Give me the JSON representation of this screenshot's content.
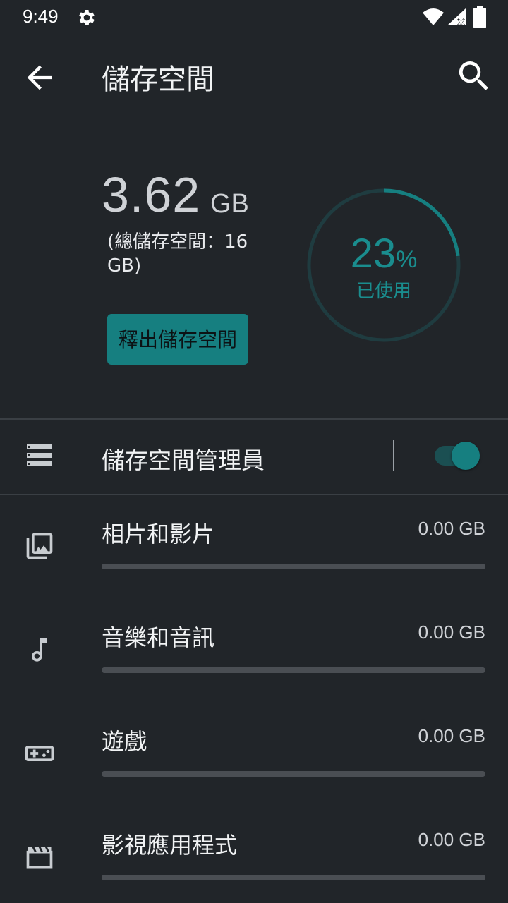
{
  "status": {
    "time": "9:49"
  },
  "header": {
    "title": "儲存空間"
  },
  "summary": {
    "used_value": "3.62",
    "used_unit": "GB",
    "total_text": "(總儲存空間：16 GB)",
    "free_button": "釋出儲存空間",
    "used_percent": 23,
    "percent_number": "23",
    "percent_symbol": "%",
    "used_label": "已使用"
  },
  "manager": {
    "label": "儲存空間管理員",
    "enabled": true
  },
  "categories": [
    {
      "label": "相片和影片",
      "size": "0.00 GB",
      "fraction": 0,
      "icon": "photo-library-icon"
    },
    {
      "label": "音樂和音訊",
      "size": "0.00 GB",
      "fraction": 0,
      "icon": "music-note-icon"
    },
    {
      "label": "遊戲",
      "size": "0.00 GB",
      "fraction": 0,
      "icon": "gamepad-icon"
    },
    {
      "label": "影視應用程式",
      "size": "0.00 GB",
      "fraction": 0,
      "icon": "movie-icon"
    }
  ],
  "colors": {
    "accent": "#167f80",
    "background": "#212529",
    "track": "#4a4e53"
  }
}
